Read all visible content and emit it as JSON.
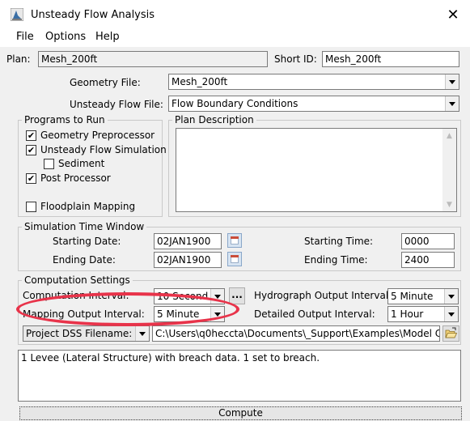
{
  "window": {
    "title": "Unsteady Flow Analysis",
    "close_glyph": "✕"
  },
  "menu": [
    "File",
    "Options",
    "Help"
  ],
  "plan": {
    "label": "Plan:",
    "value": "Mesh_200ft",
    "short_id_label": "Short ID:",
    "short_id_value": "Mesh_200ft"
  },
  "geometry": {
    "label": "Geometry File:",
    "value": "Mesh_200ft"
  },
  "unsteady": {
    "label": "Unsteady Flow File:",
    "value": "Flow Boundary Conditions"
  },
  "programs": {
    "title": "Programs to Run",
    "items": [
      {
        "label": "Geometry Preprocessor",
        "checked": true
      },
      {
        "label": "Unsteady Flow Simulation",
        "checked": true
      },
      {
        "label": "Sediment",
        "checked": false
      },
      {
        "label": "Post Processor",
        "checked": true
      },
      {
        "label": "Floodplain Mapping",
        "checked": false
      }
    ]
  },
  "plan_description": {
    "title": "Plan Description",
    "text": ""
  },
  "sim_time": {
    "title": "Simulation Time Window",
    "start_date_label": "Starting Date:",
    "start_date": "02JAN1900",
    "end_date_label": "Ending Date:",
    "end_date": "02JAN1900",
    "start_time_label": "Starting Time:",
    "start_time": "0000",
    "end_time_label": "Ending Time:",
    "end_time": "2400"
  },
  "comp": {
    "title": "Computation Settings",
    "interval_label": "Computation Interval:",
    "interval_value": "10 Second",
    "ellipsis": "...",
    "hydro_label": "Hydrograph Output Interval:",
    "hydro_value": "5 Minute",
    "mapping_label": "Mapping Output Interval:",
    "mapping_value": "5 Minute",
    "detailed_label": "Detailed Output Interval:",
    "detailed_value": "1 Hour",
    "dss_label": "Project DSS Filename:",
    "dss_path": "C:\\Users\\q0heccta\\Documents\\_Support\\Examples\\Model C"
  },
  "status": "1 Levee (Lateral Structure) with breach data.  1 set to breach.",
  "compute_label": "Compute",
  "colors": {
    "annotation": "#e8334a",
    "window_bg": "#f0f0f0"
  }
}
